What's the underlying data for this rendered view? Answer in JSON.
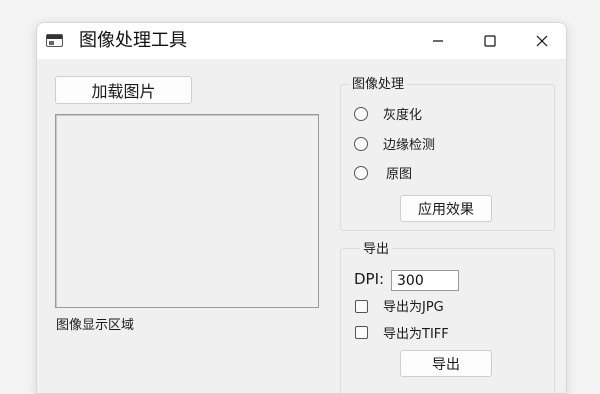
{
  "window": {
    "title": "图像处理工具"
  },
  "left": {
    "load_button": "加载图片",
    "image_area_label": "图像显示区域"
  },
  "processing": {
    "group_title": "图像处理",
    "options": [
      {
        "label": "灰度化",
        "selected": false
      },
      {
        "label": "边缘检测",
        "selected": false
      },
      {
        "label": "原图",
        "selected": false
      }
    ],
    "apply_button": "应用效果"
  },
  "export": {
    "group_title": "导出",
    "dpi_label": "DPI:",
    "dpi_value": "300",
    "checkboxes": [
      {
        "label": "导出为JPG",
        "checked": false
      },
      {
        "label": "导出为TIFF",
        "checked": false
      }
    ],
    "export_button": "导出"
  },
  "icons": {
    "app": "app-window-icon",
    "minimize": "minimize-icon",
    "maximize": "maximize-icon",
    "close": "close-icon"
  }
}
